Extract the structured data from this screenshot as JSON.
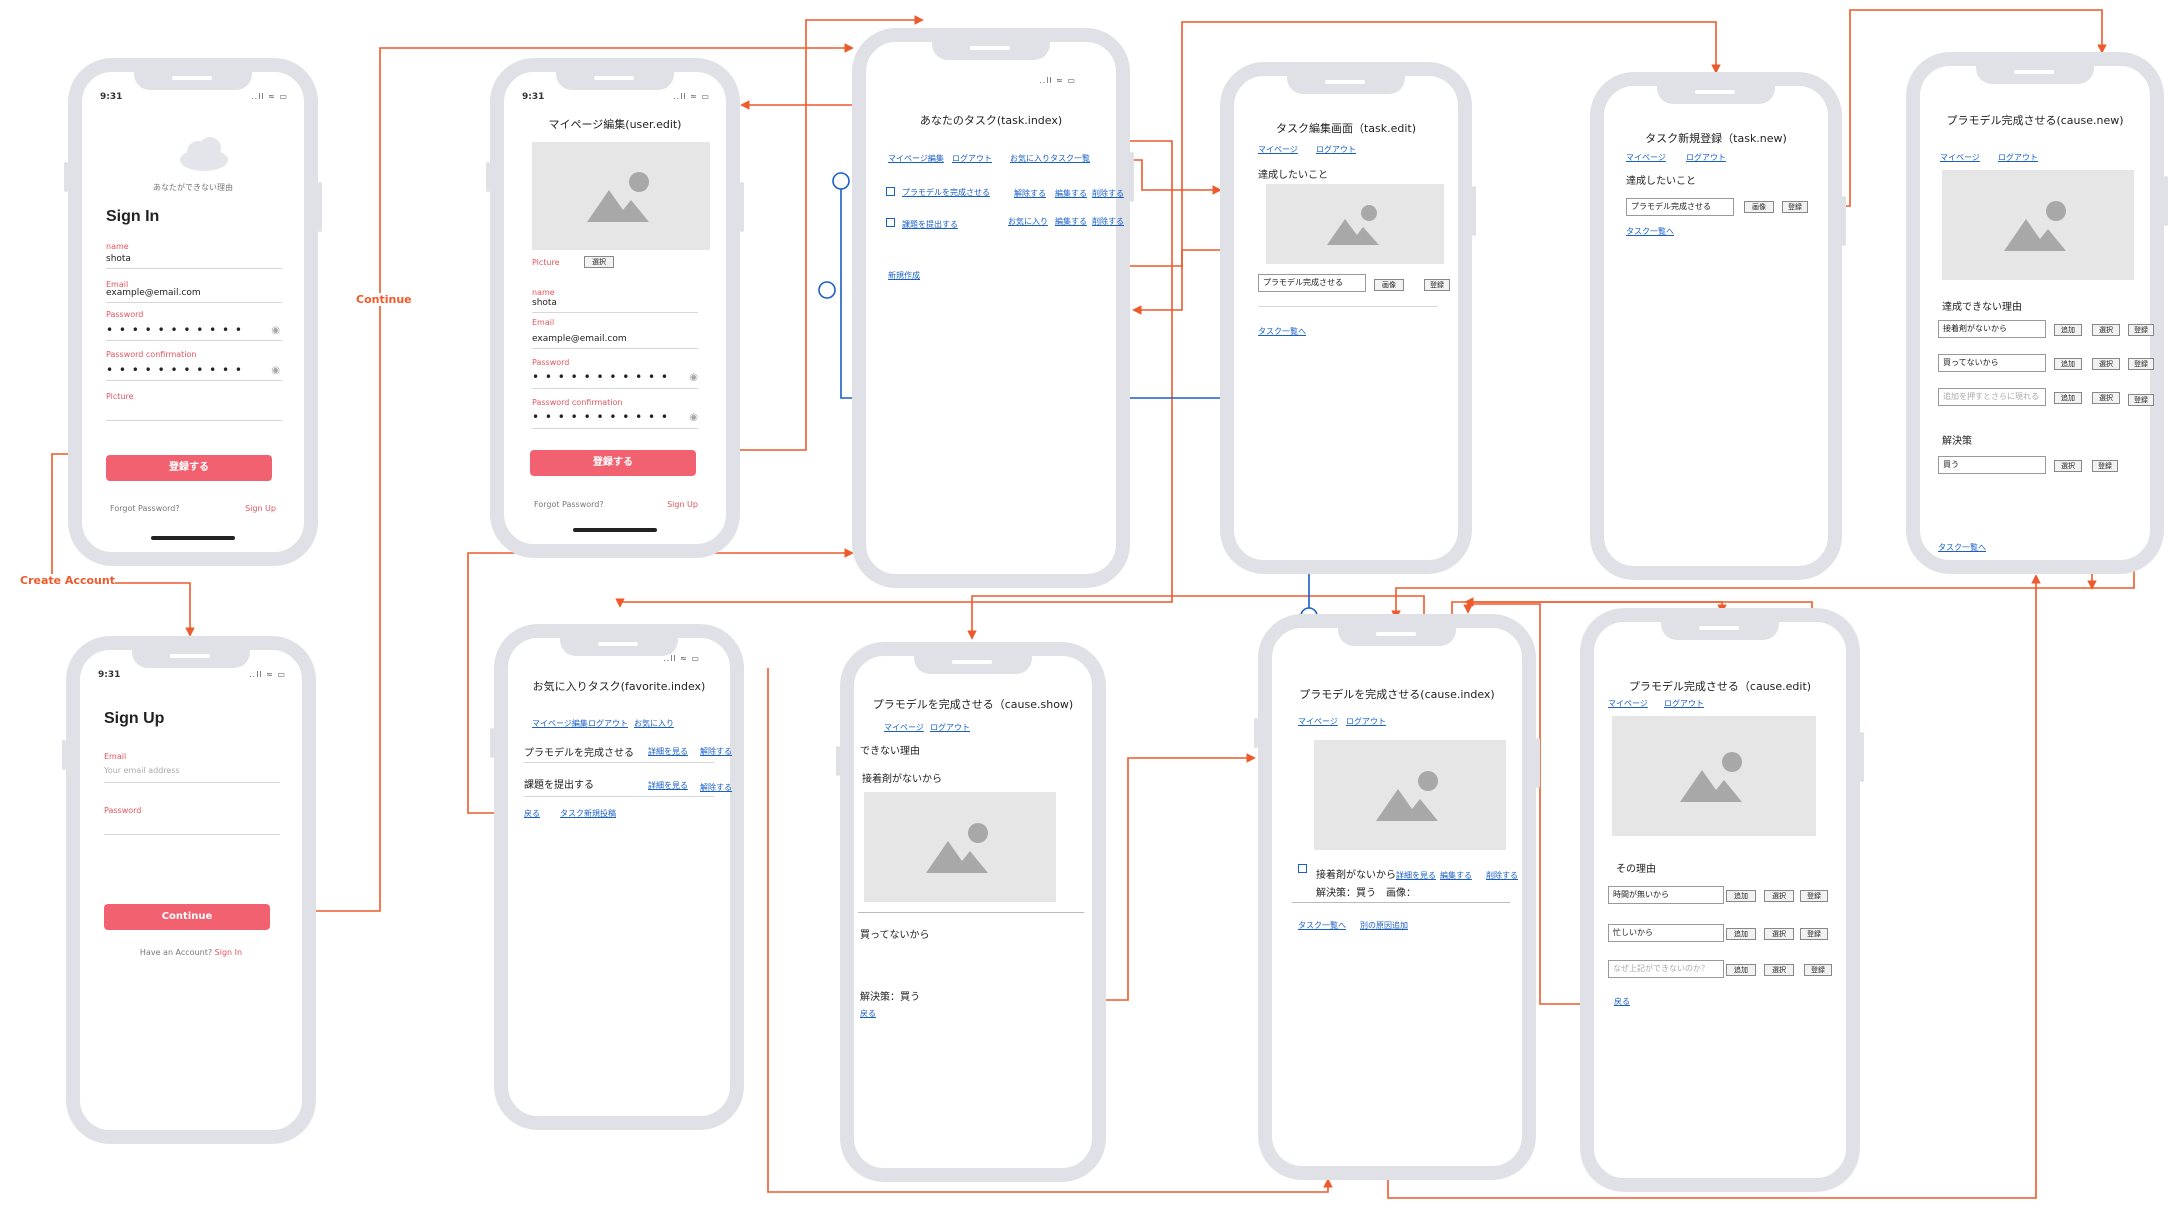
{
  "colors": {
    "accent": "#f2616f",
    "flow": "#ee5a2b",
    "link": "#1a5fc8",
    "node": "#1a5fc8"
  },
  "flow_labels": {
    "create_account": "Create Account",
    "continue": "Continue"
  },
  "common": {
    "time": "9:31",
    "status": "..ll  ≈  ▭",
    "icon_image": "image-placeholder-icon"
  },
  "signin": {
    "app_tagline": "あなたができない理由",
    "title": "Sign In",
    "name_label": "name",
    "name_value": "shota",
    "email_label": "Email",
    "email_value": "example@email.com",
    "password_label": "Password",
    "password_dots": "• • • • • • • • • • •",
    "password_confirmation_label": "Password confirmation",
    "password_confirmation_dots": "• • • • • • • • • • •",
    "picture_label": "Picture",
    "submit": "登録する",
    "forgot": "Forgot Password?",
    "signup": "Sign Up"
  },
  "signup": {
    "title": "Sign Up",
    "email_label": "Email",
    "email_placeholder": "Your email address",
    "password_label": "Password",
    "submit": "Continue",
    "have_account": "Have an Account?",
    "signin": "Sign In"
  },
  "useredit": {
    "title": "マイページ編集(user.edit)",
    "picture_label": "Picture",
    "select": "選択",
    "name_label": "name",
    "name_value": "shota",
    "email_label": "Email",
    "email_value": "example@email.com",
    "password_label": "Password",
    "password_dots": "• • • • • • • • • • •",
    "password_confirmation_label": "Password confirmation",
    "password_confirmation_dots": "• • • • • • • • • • •",
    "submit": "登録する",
    "forgot": "Forgot Password?",
    "signup": "Sign Up"
  },
  "taskindex": {
    "title": "あなたのタスク(task.index)",
    "nav": [
      "マイページ編集",
      "ログアウト",
      "お気に入りタスク一覧"
    ],
    "rows": [
      {
        "name": "プラモデルを完成させる",
        "actions": [
          "解除する",
          "編集する",
          "削除する"
        ]
      },
      {
        "name": "課題を提出する",
        "actions": [
          "お気に入り",
          "編集する",
          "削除する"
        ]
      }
    ],
    "new": "新規作成"
  },
  "taskedit": {
    "title": "タスク編集画面（task.edit)",
    "nav": [
      "マイページ",
      "ログアウト"
    ],
    "heading": "達成したいこと",
    "input_value": "プラモデル完成させる",
    "image_btn": "画像",
    "register_btn": "登録",
    "back": "タスク一覧へ"
  },
  "tasknew": {
    "title": "タスク新規登録（task.new)",
    "nav": [
      "マイページ",
      "ログアウト"
    ],
    "heading": "達成したいこと",
    "input_value": "プラモデル完成させる",
    "image_btn": "画像",
    "register_btn": "登録",
    "back": "タスク一覧へ"
  },
  "causenew": {
    "title": "プラモデル完成させる(cause.new)",
    "nav": [
      "マイページ",
      "ログアウト"
    ],
    "reasons_heading": "達成できない理由",
    "reasons": [
      {
        "text": "接着剤がないから",
        "empty": false
      },
      {
        "text": "買ってないから",
        "empty": false
      },
      {
        "text": "追加を押すとさらに現れる",
        "empty": true
      }
    ],
    "add": "追加",
    "select": "選択",
    "register": "登録",
    "solution_heading": "解決策",
    "solution_value": "買う",
    "back": "タスク一覧へ"
  },
  "favorite": {
    "title": "お気に入りタスク(favorite.index)",
    "nav": [
      "マイページ編集",
      "ログアウト",
      "お気に入り"
    ],
    "rows": [
      {
        "name": "プラモデルを完成させる",
        "actions": [
          "詳細を見る",
          "解除する"
        ]
      },
      {
        "name": "課題を提出する",
        "actions": [
          "詳細を見る",
          "解除する"
        ]
      }
    ],
    "back": "戻る",
    "new_post": "タスク新規投稿"
  },
  "causeshow": {
    "title": "プラモデルを完成させる（cause.show)",
    "nav": [
      "マイページ",
      "ログアウト"
    ],
    "heading": "できない理由",
    "reason1": "接着剤がないから",
    "reason2": "買ってないから",
    "solution": "解決策：買う",
    "back": "戻る"
  },
  "causeindex": {
    "title": "プラモデルを完成させる(cause.index)",
    "nav": [
      "マイページ",
      "ログアウト"
    ],
    "row_text": "接着剤がないから",
    "actions": [
      "詳細を見る",
      "編集する",
      "削除する"
    ],
    "detail": "解決策：買う　画像：",
    "back": "タスク一覧へ",
    "add_other": "別の原因追加"
  },
  "causeedit": {
    "title": "プラモデル完成させる（cause.edit)",
    "nav": [
      "マイページ",
      "ログアウト"
    ],
    "heading": "その理由",
    "reasons": [
      {
        "text": "時間が無いから",
        "empty": false
      },
      {
        "text": "忙しいから",
        "empty": false
      },
      {
        "text": "なぜ上記ができないのか？",
        "empty": true
      }
    ],
    "add": "追加",
    "select": "選択",
    "register": "登録",
    "back": "戻る"
  }
}
